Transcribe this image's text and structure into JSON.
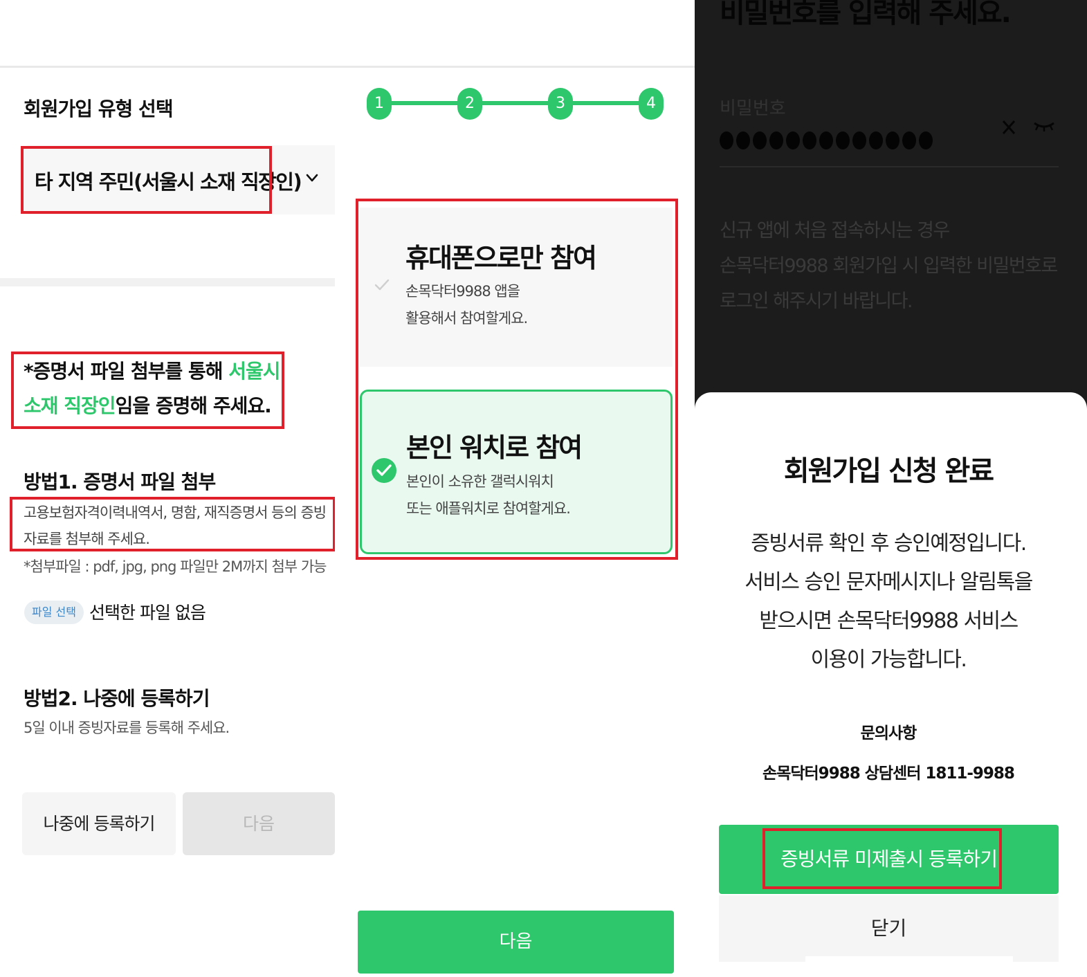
{
  "panel1": {
    "title": "회원가입 유형 선택",
    "selected_type": "타 지역 주민(서울시 소재 직장인)",
    "notice_prefix": "*증명서 파일 첨부를 통해 ",
    "notice_highlight": "서울시 소재 직장인",
    "notice_suffix": "임을 증명해 주세요.",
    "method1_title": "방법1. 증명서 파일 첨부",
    "method1_desc": "고용보험자격이력내역서, 명함, 재직증명서 등의 증빙자료를 첨부해 주세요.",
    "method1_note": "*첨부파일 : pdf, jpg, png 파일만 2M까지 첨부 가능",
    "file_button": "파일 선택",
    "file_status": "선택한 파일 없음",
    "method2_title": "방법2. 나중에 등록하기",
    "method2_desc": "5일 이내 증빙자료를 등록해 주세요.",
    "later_button": "나중에 등록하기",
    "next_button": "다음"
  },
  "panel2": {
    "steps": [
      "1",
      "2",
      "3",
      "4"
    ],
    "option1_title": "휴대폰으로만 참여",
    "option1_desc_line1": "손목닥터9988 앱을",
    "option1_desc_line2": "활용해서 참여할게요.",
    "option2_title": "본인 워치로 참여",
    "option2_desc_line1": "본인이 소유한 갤럭시워치",
    "option2_desc_line2": "또는 애플워치로 참여할게요.",
    "selected_option": 2,
    "next_button": "다음"
  },
  "panel3": {
    "bg_heading": "비밀번호를 입력해 주세요.",
    "password_label": "비밀번호",
    "password_length": 13,
    "bg_notice_line1": "신규 앱에 처음 접속하시는 경우",
    "bg_notice_line2": "손목닥터9988 회원가입 시 입력한 비밀번호로",
    "bg_notice_line3": "로그인 해주시기 바랍니다.",
    "sheet_title": "회원가입 신청 완료",
    "sheet_body_line1": "증빙서류 확인 후 승인예정입니다.",
    "sheet_body_line2": "서비스 승인 문자메시지나 알림톡을",
    "sheet_body_line3": "받으시면 손목닥터9988 서비스",
    "sheet_body_line4": "이용이 가능합니다.",
    "inquiry_label": "문의사항",
    "inquiry_contact": "손목닥터9988 상담센터 1811-9988",
    "register_button": "증빙서류 미제출시 등록하기",
    "close_button": "닫기"
  },
  "colors": {
    "accent_green": "#2ec76c",
    "highlight_red": "#e0202a",
    "overlay_dark": "#1c1c1c"
  }
}
